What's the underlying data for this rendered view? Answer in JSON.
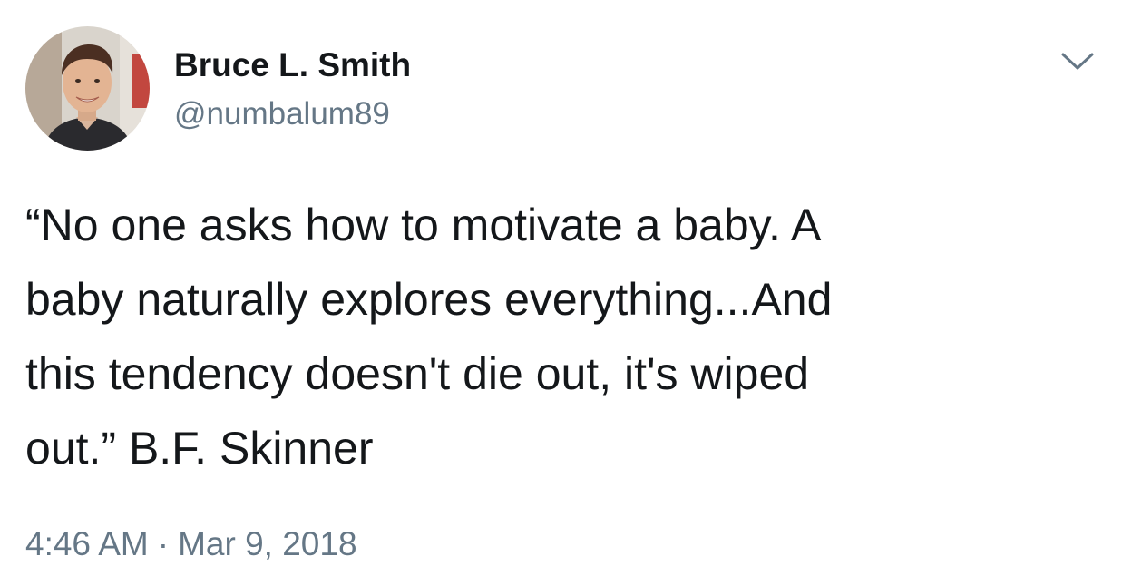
{
  "author": {
    "display_name": "Bruce L. Smith",
    "handle": "@numbalum89"
  },
  "tweet": {
    "text_lines": [
      "“No one asks how to motivate a baby. A",
      "baby naturally explores everything...And",
      "this tendency doesn't die out, it's wiped",
      "out.” B.F. Skinner"
    ]
  },
  "meta": {
    "time": "4:46 AM",
    "separator": "·",
    "date": "Mar 9, 2018"
  },
  "icons": {
    "menu": "chevron-down-icon",
    "avatar": "profile-photo"
  },
  "colors": {
    "text": "#14171a",
    "secondary": "#657786",
    "background": "#ffffff"
  }
}
